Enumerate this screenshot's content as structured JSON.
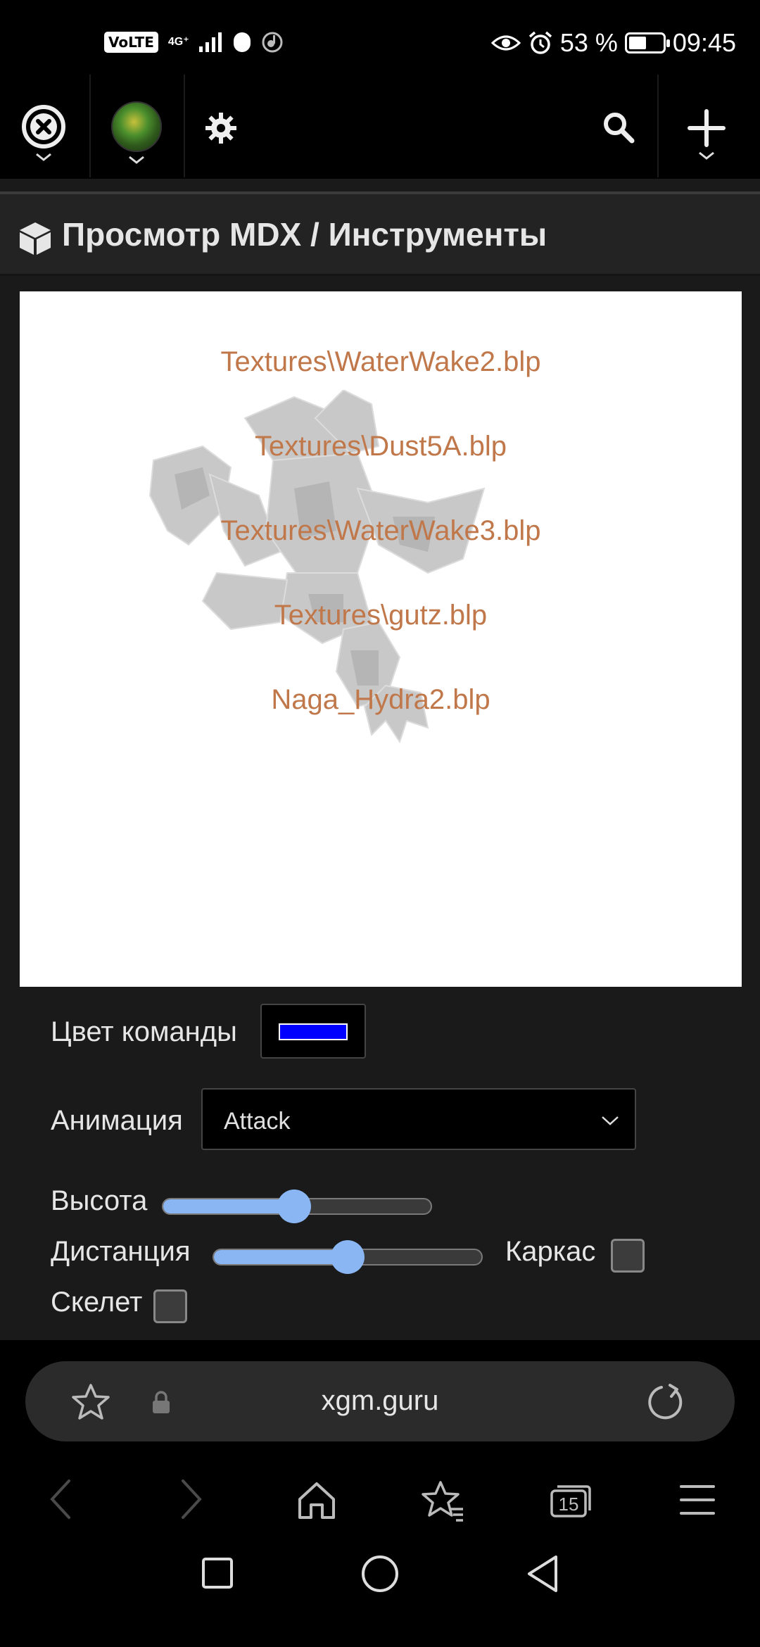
{
  "status_bar": {
    "volte": "VoLTE",
    "network": "4G⁺",
    "battery_percent": "53 %",
    "battery_level": 0.53,
    "time": "09:45"
  },
  "toolbar": {
    "icons": [
      "close-tab-icon",
      "avatar",
      "settings-icon",
      "search-icon",
      "plus-icon"
    ]
  },
  "page": {
    "title": "Просмотр MDX / Инструменты"
  },
  "viewer": {
    "texture_labels": [
      "Textures\\WaterWake2.blp",
      "Textures\\Dust5A.blp",
      "Textures\\WaterWake3.blp",
      "Textures\\gutz.blp",
      "Naga_Hydra2.blp"
    ]
  },
  "controls": {
    "team_color_label": "Цвет команды",
    "team_color_value": "#0000ff",
    "animation_label": "Анимация",
    "animation_value": "Attack",
    "height_label": "Высота",
    "height_value": 0.49,
    "distance_label": "Дистанция",
    "distance_value": 0.5,
    "wireframe_label": "Каркас",
    "wireframe_checked": false,
    "skeleton_label": "Скелет",
    "skeleton_checked": false
  },
  "bottom_bar": {
    "url": "xgm.guru",
    "tabs_count": "15"
  },
  "colors": {
    "accent": "#8ab6f3",
    "texture_label": "#c0774a",
    "page_bg": "#1a1a1a"
  }
}
